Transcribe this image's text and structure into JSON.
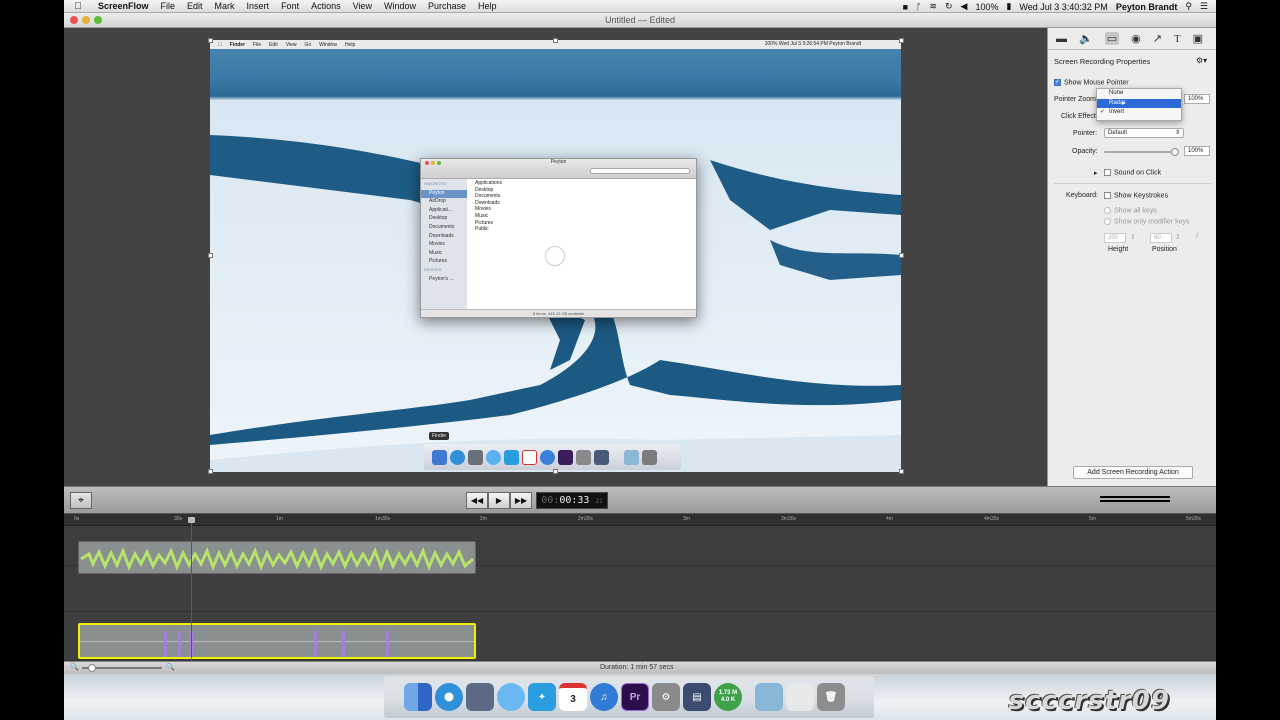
{
  "menubar": {
    "app_name": "ScreenFlow",
    "items": [
      "File",
      "Edit",
      "Mark",
      "Insert",
      "Font",
      "Actions",
      "View",
      "Window",
      "Purchase",
      "Help"
    ],
    "battery": "100%",
    "clock": "Wed Jul 3  3:40:32 PM",
    "user": "Peyton Brandt"
  },
  "window": {
    "title": "Untitled — Edited"
  },
  "recording": {
    "menu_items": [
      "Finder",
      "File",
      "Edit",
      "View",
      "Go",
      "Window",
      "Help"
    ],
    "menu_right": "100%  Wed Jul 3  3:26:54 PM   Peyton Brandt",
    "finder_title": "Peyton",
    "sidebar_header": "FAVORITES",
    "sidebar_items": [
      "Peyton",
      "AirDrop",
      "Applicati...",
      "Desktop",
      "Documents",
      "Downloads",
      "Movies",
      "Music",
      "Pictures"
    ],
    "devices_header": "DEVICES",
    "device_items": [
      "Peyton's ..."
    ],
    "files": [
      "Applications",
      "Desktop",
      "Documents",
      "Downloads",
      "Movies",
      "Music",
      "Pictures",
      "Public"
    ],
    "status": "8 items, 445.12 GB available",
    "dock_label": "Finder"
  },
  "inspector": {
    "tab_icons": [
      "video-icon",
      "audio-icon",
      "screen-recording-icon",
      "callout-icon",
      "annotation-icon",
      "text-icon",
      "media-icon"
    ],
    "title": "Screen Recording Properties",
    "show_mouse_pointer": "Show Mouse Pointer",
    "pointer_zoom_label": "Pointer Zoom:",
    "pointer_zoom_value": "100%",
    "click_effect_label": "Click Effect",
    "click_effect_options": [
      "None",
      "Radar",
      "Invert"
    ],
    "click_effect_highlighted": "Radar",
    "click_effect_checked": "Invert",
    "pointer_label": "Pointer:",
    "pointer_value": "Default",
    "opacity_label": "Opacity:",
    "opacity_value": "100%",
    "sound_on_click": "Sound on Click",
    "keyboard_label": "Keyboard:",
    "show_keystrokes": "Show Keystrokes",
    "show_all_keys": "Show all keys",
    "show_modifier_keys": "Show only modifier keys",
    "height_value": "200",
    "position_value": "80",
    "height_label": "Height",
    "position_label": "Position",
    "add_action": "Add Screen Recording Action"
  },
  "transport": {
    "timecode_dim": "00:",
    "timecode": "00:33",
    "timecode_frames": "21"
  },
  "timeline": {
    "ruler": [
      "0s",
      "30s",
      "1m",
      "1m30s",
      "2m",
      "2m30s",
      "3m",
      "3m30s",
      "4m",
      "4m30s",
      "5m",
      "5m30s"
    ]
  },
  "footer": {
    "duration": "Duration: 1 min 57 secs"
  },
  "dock": {
    "calendar_day": "3",
    "premiere": "Pr",
    "network_up": "1.73 M",
    "network_down": "4.0 K"
  },
  "watermark": "scccrstr09"
}
